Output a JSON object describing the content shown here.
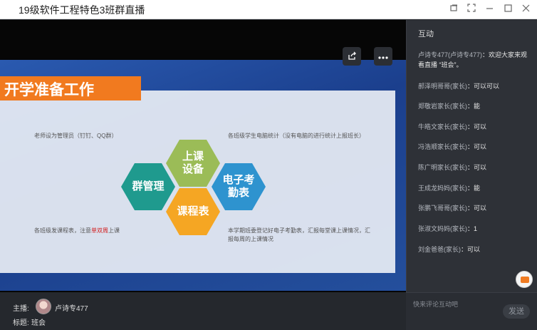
{
  "window": {
    "title": "19级软件工程特色3班群直播",
    "controls": [
      "restore-window-icon",
      "fullscreen-icon",
      "minimize-icon",
      "maximize-icon",
      "close-icon"
    ]
  },
  "slide": {
    "title": "开学准备工作",
    "note_top_left": "老师设为管理员（钉钉、QQ群）",
    "note_top_right": "各班级学生电脑统计（没有电脑的进行统计上报班长）",
    "note_bottom_left_pre": "各班级发课程表，注意",
    "note_bottom_left_red": "单双周",
    "note_bottom_left_post": "上课",
    "note_bottom_right": "本学期班委登记好电子考勤表，汇报每堂课上课情况，汇报每周的上课情况",
    "hexagons": {
      "group": "群管理",
      "equipment": "上课设备",
      "schedule": "课程表",
      "attendance": "电子考勤表"
    },
    "colors": {
      "group": "#1f9a8e",
      "equipment": "#9bbc57",
      "schedule": "#f5a623",
      "attendance": "#2e93cf",
      "title_bar": "#f17a1f"
    }
  },
  "video_controls": [
    "share-icon",
    "more-icon"
  ],
  "stream_info": {
    "host_label": "主播:",
    "host_name": "卢诗专477",
    "topic_label": "标题:",
    "topic": "班会"
  },
  "panel": {
    "title": "互动",
    "messages": [
      {
        "name": "卢诗专477(卢诗专477)",
        "text": "：欢迎大家来观看直播 “班会”。"
      },
      {
        "name": "郝泽明哥哥(家长)",
        "text": "：可以可以"
      },
      {
        "name": "郑敬岩家长(家长)",
        "text": "：能"
      },
      {
        "name": "牛皓文家长(家长)",
        "text": "：可以"
      },
      {
        "name": "冯浩顺家长(家长)",
        "text": "：可以"
      },
      {
        "name": "陈广明家长(家长)",
        "text": "：可以"
      },
      {
        "name": "王成龙妈妈(家长)",
        "text": "：能"
      },
      {
        "name": "张鹏飞哥哥(家长)",
        "text": "：可以"
      },
      {
        "name": "张淑文妈妈(家长)",
        "text": "：1"
      },
      {
        "name": "刘金爸爸(家长)",
        "text": "：可以"
      }
    ],
    "input_placeholder": "快来评论互动吧",
    "send_label": "发送"
  }
}
